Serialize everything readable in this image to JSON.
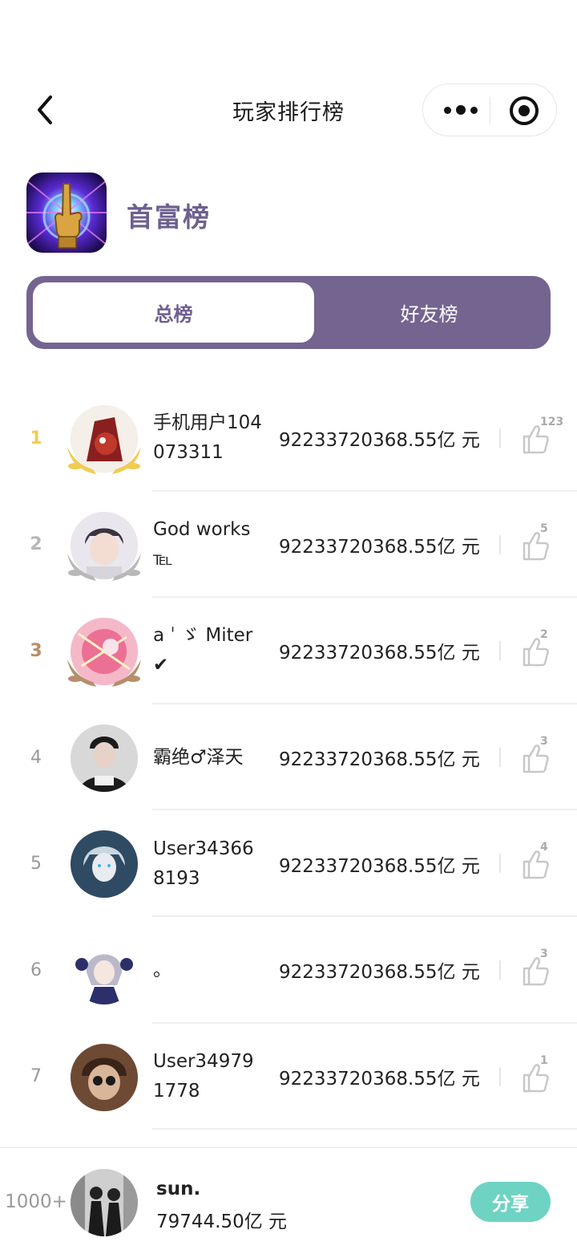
{
  "header": {
    "title": "玩家排行榜",
    "back_icon": "chevron-left-icon",
    "more_icon": "more-dots-icon",
    "close_icon": "target-icon"
  },
  "board": {
    "title": "首富榜",
    "icon": "golden-finger-icon"
  },
  "tabs": [
    {
      "label": "总榜",
      "active": true
    },
    {
      "label": "好友榜",
      "active": false
    }
  ],
  "rows": [
    {
      "rank": "1",
      "name": "手机用户104073311",
      "amount": "92233720368.55亿 元",
      "likes": "123",
      "medal": "gold",
      "avatar_colors": [
        "#f4efe8",
        "#c0392b"
      ]
    },
    {
      "rank": "2",
      "name": "God works℡",
      "amount": "92233720368.55亿 元",
      "likes": "5",
      "medal": "silver",
      "avatar_colors": [
        "#e9e6ee",
        "#3a3440"
      ]
    },
    {
      "rank": "3",
      "name": "a ˈ ゞ Miter✔",
      "amount": "92233720368.55亿 元",
      "likes": "2",
      "medal": "bronze",
      "avatar_colors": [
        "#f5b8c8",
        "#d9306e"
      ]
    },
    {
      "rank": "4",
      "name": "霸绝♂泽天",
      "amount": "92233720368.55亿 元",
      "likes": "3",
      "medal": "none",
      "avatar_colors": [
        "#d8d8d8",
        "#1b1b1b"
      ]
    },
    {
      "rank": "5",
      "name": "User343668193",
      "amount": "92233720368.55亿 元",
      "likes": "4",
      "medal": "none",
      "avatar_colors": [
        "#2f4a63",
        "#c9d6e2"
      ]
    },
    {
      "rank": "6",
      "name": "。",
      "amount": "92233720368.55亿 元",
      "likes": "3",
      "medal": "none",
      "avatar_colors": [
        "#ffffff",
        "#2c2f6a"
      ]
    },
    {
      "rank": "7",
      "name": "User349791778",
      "amount": "92233720368.55亿 元",
      "likes": "1",
      "medal": "none",
      "avatar_colors": [
        "#6e4a34",
        "#1a1a1a"
      ]
    }
  ],
  "me": {
    "rank": "1000+",
    "name": "sun.",
    "amount": "79744.50亿 元",
    "share_label": "分享"
  },
  "colors": {
    "accent": "#736490",
    "accent_text": "#6e5f8f",
    "share": "#6ed3c3",
    "gold": "#f0cc55",
    "silver": "#b8b8b8",
    "bronze": "#b58e6a"
  }
}
